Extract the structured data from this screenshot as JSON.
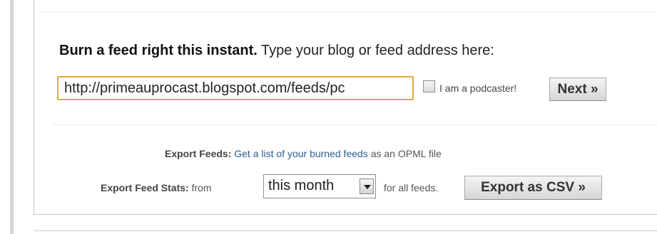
{
  "burn": {
    "headline_bold": "Burn a feed right this instant.",
    "headline_rest": " Type your blog or feed address here:",
    "feed_value": "http://primeauprocast.blogspot.com/feeds/pc",
    "podcaster_label": "I am a podcaster!",
    "podcaster_checked": false,
    "next_label": "Next »"
  },
  "export": {
    "feeds_label": "Export Feeds:",
    "feeds_link": "Get a list of your burned feeds",
    "feeds_suffix": " as an OPML file",
    "stats_label": "Export Feed Stats:",
    "stats_from": " from",
    "period_value": "this month",
    "stats_suffix": "for all feeds.",
    "csv_label": "Export as CSV »"
  },
  "colors": {
    "input_focus_border": "#e3a83d",
    "link": "#2a5f8f"
  },
  "icons": {
    "dropdown": "chevron-down-icon"
  }
}
